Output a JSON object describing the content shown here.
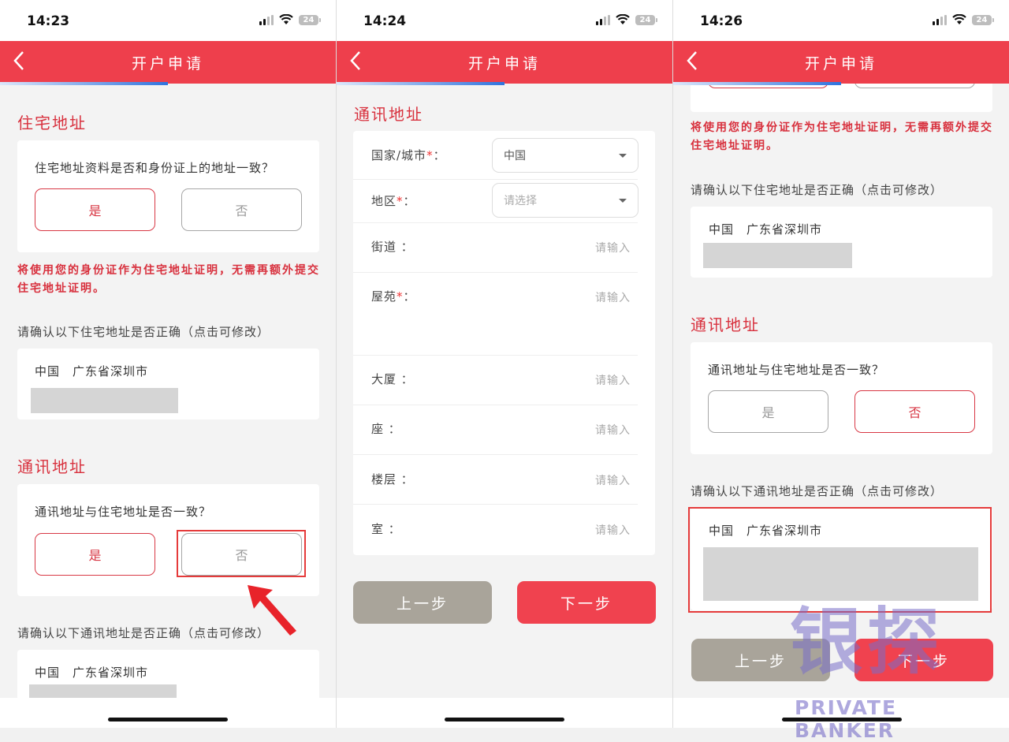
{
  "status": {
    "time1": "14:23",
    "time2": "14:24",
    "time3": "14:26",
    "battery": "24"
  },
  "header": {
    "title": "开户申请"
  },
  "residential": {
    "section_title": "住宅地址",
    "question": "住宅地址资料是否和身份证上的地址一致？",
    "yes": "是",
    "no": "否",
    "note": "将使用您的身份证作为住宅地址证明，无需再额外提交住宅地址证明。",
    "confirm_label": "请确认以下住宅地址是否正确（点击可修改）",
    "address": "中国　广东省深圳市"
  },
  "mailing": {
    "section_title": "通讯地址",
    "question": "通讯地址与住宅地址是否一致？",
    "yes": "是",
    "no": "否",
    "confirm_label": "请确认以下通讯地址是否正确（点击可修改）",
    "address": "中国　广东省深圳市"
  },
  "form": {
    "section_title": "通讯地址",
    "country_label": "国家/城市",
    "country_value": "中国",
    "region_label": "地区",
    "region_placeholder": "请选择",
    "street_label": "街道 ：",
    "estate_label": "屋苑",
    "building_label": "大厦 ：",
    "block_label": "座 ：",
    "floor_label": "楼层 ：",
    "room_label": "室 ：",
    "input_placeholder": "请输入",
    "required_mark": "*",
    "colon": "："
  },
  "nav": {
    "prev": "上一步",
    "next": "下一步"
  },
  "watermark": {
    "cn": "银探",
    "en": "PRIVATE BANKER"
  }
}
